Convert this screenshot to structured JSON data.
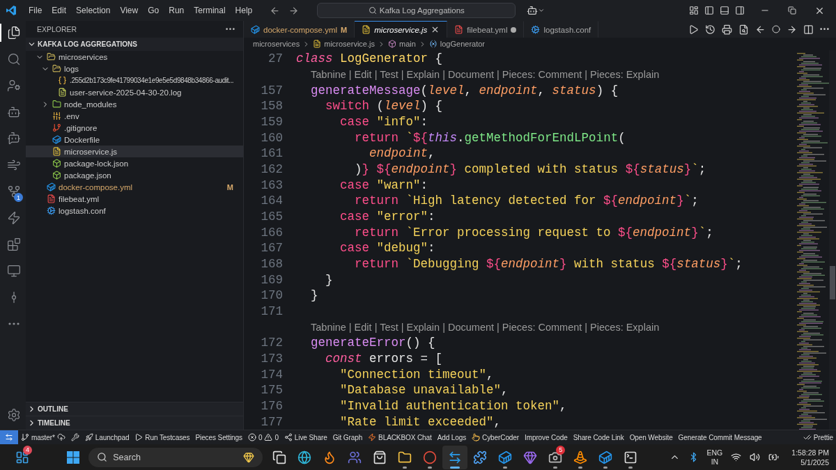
{
  "titlebar": {
    "menus": [
      "File",
      "Edit",
      "Selection",
      "View",
      "Go",
      "Run",
      "Terminal",
      "Help"
    ],
    "search": {
      "value": "Kafka Log Aggregations"
    }
  },
  "activity": [
    {
      "kind": "files",
      "selected": true
    },
    {
      "kind": "search",
      "selected": false
    },
    {
      "kind": "usercog",
      "selected": false
    },
    {
      "kind": "robot",
      "selected": false
    },
    {
      "kind": "bot",
      "selected": false
    },
    {
      "kind": "wind",
      "selected": false
    },
    {
      "kind": "git",
      "selected": false,
      "badge": "1"
    },
    {
      "kind": "zap",
      "selected": false
    },
    {
      "kind": "blocks",
      "selected": false
    },
    {
      "kind": "monitor",
      "selected": false
    },
    {
      "kind": "commit",
      "selected": false
    },
    {
      "kind": "more",
      "selected": false
    }
  ],
  "sidebar": {
    "title": "EXPLORER",
    "root": {
      "label": "KAFKA LOG AGGREGATIONS",
      "expanded": true
    },
    "tree": [
      {
        "label": "microservices",
        "kind": "folder",
        "expanded": true,
        "selected": false,
        "children": [
          {
            "label": "logs",
            "kind": "folder",
            "expanded": true,
            "selected": false,
            "children": [
              {
                "label": ".255d2b173c9fe41799034e1e9e5e5d9848b34866-audit...",
                "kind": "braces",
                "selected": false
              },
              {
                "label": "user-service-2025-04-30-20.log",
                "kind": "log",
                "selected": false
              }
            ]
          },
          {
            "label": "node_modules",
            "kind": "folder",
            "expanded": false,
            "selected": false
          },
          {
            "label": ".env",
            "kind": "env",
            "selected": false
          },
          {
            "label": ".gitignore",
            "kind": "git",
            "selected": false
          },
          {
            "label": "Dockerfile",
            "kind": "docker",
            "selected": false
          },
          {
            "label": "microservice.js",
            "kind": "js",
            "selected": true
          },
          {
            "label": "package-lock.json",
            "kind": "node",
            "selected": false
          },
          {
            "label": "package.json",
            "kind": "node",
            "selected": false
          }
        ]
      },
      {
        "label": "docker-compose.yml",
        "kind": "docker",
        "selected": false,
        "status": "M"
      },
      {
        "label": "filebeat.yml",
        "kind": "yaml",
        "selected": false
      },
      {
        "label": "logstash.conf",
        "kind": "conf",
        "selected": false
      }
    ],
    "sections": [
      {
        "label": "OUTLINE",
        "expanded": false
      },
      {
        "label": "TIMELINE",
        "expanded": false
      }
    ]
  },
  "tabs": [
    {
      "label": "docker-compose.yml",
      "kind": "docker",
      "selected": false,
      "status": "M",
      "dirty": false
    },
    {
      "label": "microservice.js",
      "kind": "js",
      "selected": true,
      "dirty": false
    },
    {
      "label": "filebeat.yml",
      "kind": "yaml",
      "selected": false,
      "dirty": true
    },
    {
      "label": "logstash.conf",
      "kind": "conf",
      "selected": false,
      "dirty": false
    }
  ],
  "breadcrumb": [
    {
      "label": "microservices",
      "kind": "text"
    },
    {
      "label": "microservice.js",
      "kind": "js"
    },
    {
      "label": "main",
      "kind": "cube"
    },
    {
      "label": "logGenerator",
      "kind": "var"
    }
  ],
  "code": [
    {
      "number": "27",
      "tokens": [
        {
          "kind": "kwi",
          "text": "class"
        },
        {
          "kind": "cls",
          "text": " LogGenerator"
        },
        {
          "kind": "p",
          "text": " {"
        }
      ]
    },
    {
      "lens": "Tabnine | Edit | Test | Explain | Document | Pieces: Comment | Pieces: Explain"
    },
    {
      "number": "157",
      "tokens": [
        {
          "kind": "fn",
          "text": "  generateMessage"
        },
        {
          "kind": "p",
          "text": "("
        },
        {
          "kind": "par",
          "text": "level"
        },
        {
          "kind": "p",
          "text": ", "
        },
        {
          "kind": "par",
          "text": "endpoint"
        },
        {
          "kind": "p",
          "text": ", "
        },
        {
          "kind": "par",
          "text": "status"
        },
        {
          "kind": "p",
          "text": ") {"
        }
      ]
    },
    {
      "number": "158",
      "tokens": [
        {
          "kind": "kw",
          "text": "    switch"
        },
        {
          "kind": "p",
          "text": " ("
        },
        {
          "kind": "par",
          "text": "level"
        },
        {
          "kind": "p",
          "text": ") {"
        }
      ]
    },
    {
      "number": "159",
      "tokens": [
        {
          "kind": "kw",
          "text": "      case"
        },
        {
          "kind": "str",
          "text": " \"info\""
        },
        {
          "kind": "p",
          "text": ":"
        }
      ]
    },
    {
      "number": "160",
      "tokens": [
        {
          "kind": "kw",
          "text": "        return"
        },
        {
          "kind": "str",
          "text": " `"
        },
        {
          "kind": "tpl",
          "text": "${"
        },
        {
          "kind": "this",
          "text": "this"
        },
        {
          "kind": "p",
          "text": "."
        },
        {
          "kind": "call",
          "text": "getMethodForEndLPoint"
        },
        {
          "kind": "p",
          "text": "("
        }
      ]
    },
    {
      "number": "161",
      "tokens": [
        {
          "kind": "par",
          "text": "          endpoint"
        },
        {
          "kind": "p",
          "text": ","
        }
      ]
    },
    {
      "number": "162",
      "tokens": [
        {
          "kind": "p",
          "text": "        )"
        },
        {
          "kind": "tpl",
          "text": "}"
        },
        {
          "kind": "tpl",
          "text": " ${"
        },
        {
          "kind": "par",
          "text": "endpoint"
        },
        {
          "kind": "tpl",
          "text": "}"
        },
        {
          "kind": "str",
          "text": " completed with status "
        },
        {
          "kind": "tpl",
          "text": "${"
        },
        {
          "kind": "par",
          "text": "status"
        },
        {
          "kind": "tpl",
          "text": "}"
        },
        {
          "kind": "str",
          "text": "`"
        },
        {
          "kind": "p",
          "text": ";"
        }
      ]
    },
    {
      "number": "163",
      "tokens": [
        {
          "kind": "kw",
          "text": "      case"
        },
        {
          "kind": "str",
          "text": " \"warn\""
        },
        {
          "kind": "p",
          "text": ":"
        }
      ]
    },
    {
      "number": "164",
      "tokens": [
        {
          "kind": "kw",
          "text": "        return"
        },
        {
          "kind": "str",
          "text": " `High latency detected for "
        },
        {
          "kind": "tpl",
          "text": "${"
        },
        {
          "kind": "par",
          "text": "endpoint"
        },
        {
          "kind": "tpl",
          "text": "}"
        },
        {
          "kind": "str",
          "text": "`"
        },
        {
          "kind": "p",
          "text": ";"
        }
      ]
    },
    {
      "number": "165",
      "tokens": [
        {
          "kind": "kw",
          "text": "      case"
        },
        {
          "kind": "str",
          "text": " \"error\""
        },
        {
          "kind": "p",
          "text": ":"
        }
      ]
    },
    {
      "number": "166",
      "tokens": [
        {
          "kind": "kw",
          "text": "        return"
        },
        {
          "kind": "str",
          "text": " `Error processing request to "
        },
        {
          "kind": "tpl",
          "text": "${"
        },
        {
          "kind": "par",
          "text": "endpoint"
        },
        {
          "kind": "tpl",
          "text": "}"
        },
        {
          "kind": "str",
          "text": "`"
        },
        {
          "kind": "p",
          "text": ";"
        }
      ]
    },
    {
      "number": "167",
      "tokens": [
        {
          "kind": "kw",
          "text": "      case"
        },
        {
          "kind": "str",
          "text": " \"debug\""
        },
        {
          "kind": "p",
          "text": ":"
        }
      ]
    },
    {
      "number": "168",
      "tokens": [
        {
          "kind": "kw",
          "text": "        return"
        },
        {
          "kind": "str",
          "text": " `Debugging "
        },
        {
          "kind": "tpl",
          "text": "${"
        },
        {
          "kind": "par",
          "text": "endpoint"
        },
        {
          "kind": "tpl",
          "text": "}"
        },
        {
          "kind": "str",
          "text": " with status "
        },
        {
          "kind": "tpl",
          "text": "${"
        },
        {
          "kind": "par",
          "text": "status"
        },
        {
          "kind": "tpl",
          "text": "}"
        },
        {
          "kind": "str",
          "text": "`"
        },
        {
          "kind": "p",
          "text": ";"
        }
      ]
    },
    {
      "number": "169",
      "tokens": [
        {
          "kind": "p",
          "text": "    }"
        }
      ]
    },
    {
      "number": "170",
      "tokens": [
        {
          "kind": "p",
          "text": "  }"
        }
      ]
    },
    {
      "number": "171"
    },
    {
      "lens": "Tabnine | Edit | Test | Explain | Document | Pieces: Comment | Pieces: Explain"
    },
    {
      "number": "172",
      "tokens": [
        {
          "kind": "fn",
          "text": "  generateError"
        },
        {
          "kind": "p",
          "text": "() {"
        }
      ]
    },
    {
      "number": "173",
      "tokens": [
        {
          "kind": "kwi",
          "text": "    const"
        },
        {
          "kind": "p",
          "text": " errors = ["
        }
      ]
    },
    {
      "number": "174",
      "tokens": [
        {
          "kind": "str",
          "text": "      \"Connection timeout\""
        },
        {
          "kind": "p",
          "text": ","
        }
      ]
    },
    {
      "number": "175",
      "tokens": [
        {
          "kind": "str",
          "text": "      \"Database unavailable\""
        },
        {
          "kind": "p",
          "text": ","
        }
      ]
    },
    {
      "number": "176",
      "tokens": [
        {
          "kind": "str",
          "text": "      \"Invalid authentication token\""
        },
        {
          "kind": "p",
          "text": ","
        }
      ]
    },
    {
      "number": "177",
      "tokens": [
        {
          "kind": "str",
          "text": "      \"Rate limit exceeded\""
        },
        {
          "kind": "p",
          "text": ","
        }
      ]
    }
  ],
  "status_items": [
    {
      "kind": "remote"
    },
    {
      "kind": "branch",
      "label": "master*"
    },
    {
      "kind": "tool"
    },
    {
      "kind": "rocket",
      "label": "Launchpad"
    },
    {
      "kind": "play",
      "label": "Run Testcases"
    },
    {
      "kind": "plain",
      "label": "Pieces Settings"
    },
    {
      "kind": "problems",
      "errors": "0",
      "warnings": "0"
    },
    {
      "kind": "share",
      "label": "Live Share"
    },
    {
      "kind": "plain",
      "label": "Git Graph"
    },
    {
      "kind": "bolt",
      "label": "BLACKBOX Chat"
    },
    {
      "kind": "plain",
      "label": "Add Logs"
    },
    {
      "kind": "hand",
      "label": "CyberCoder"
    },
    {
      "kind": "plain",
      "label": "Improve Code"
    },
    {
      "kind": "plain",
      "label": "Share Code Link"
    },
    {
      "kind": "plain",
      "label": "Open Website"
    },
    {
      "kind": "plain",
      "label": "Generate Commit Message"
    },
    {
      "kind": "check",
      "label": "Prettie"
    }
  ],
  "taskbar": {
    "widget_badge": "4",
    "search": {
      "placeholder": "Search"
    },
    "apps": [
      {
        "kind": "taskview",
        "running": false,
        "selected": false
      },
      {
        "kind": "edge",
        "running": false,
        "selected": false
      },
      {
        "kind": "firefox",
        "running": false,
        "selected": false
      },
      {
        "kind": "teams",
        "running": false,
        "selected": false
      },
      {
        "kind": "store",
        "running": false,
        "selected": false
      },
      {
        "kind": "folder",
        "running": true,
        "selected": false
      },
      {
        "kind": "chrome",
        "running": true,
        "selected": false
      },
      {
        "kind": "vscode",
        "running": true,
        "selected": true
      },
      {
        "kind": "xmind",
        "running": false,
        "selected": false
      },
      {
        "kind": "docker",
        "running": true,
        "selected": false
      },
      {
        "kind": "crystal",
        "running": false,
        "selected": false
      },
      {
        "kind": "camera",
        "running": true,
        "selected": false,
        "badge": "5"
      },
      {
        "kind": "vlc",
        "running": true,
        "selected": false
      },
      {
        "kind": "docker",
        "running": true,
        "selected": false
      },
      {
        "kind": "terminal",
        "running": true,
        "selected": false
      }
    ],
    "language": [
      "ENG",
      "IN"
    ],
    "time": "1:58:28 PM",
    "date": "5/1/2025"
  }
}
